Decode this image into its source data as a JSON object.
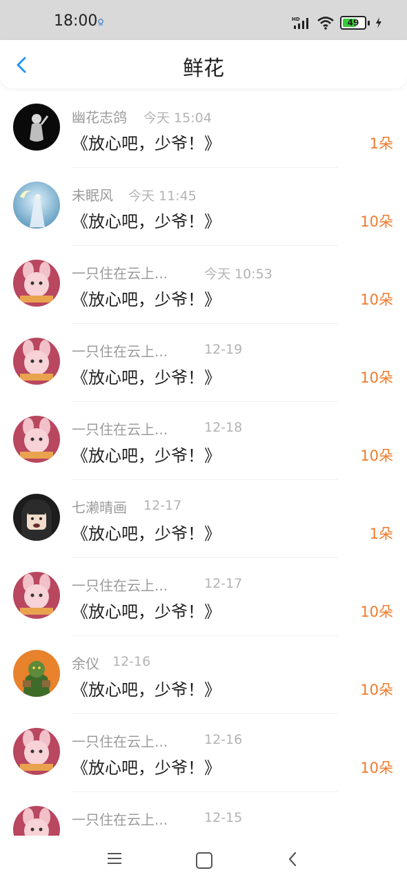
{
  "status_bar": {
    "time": "18:00",
    "battery": "49"
  },
  "header": {
    "title": "鲜花"
  },
  "rows": [
    {
      "name": "幽花志鸽",
      "time": "今天 15:04",
      "title": "《放心吧，少爷！》",
      "count": "1朵",
      "avatar": "avatar-dark-statue"
    },
    {
      "name": "未眠风",
      "time": "今天 11:45",
      "title": "《放心吧，少爷！》",
      "count": "10朵",
      "avatar": "avatar-blue-fantasy"
    },
    {
      "name": "一只住在云上...",
      "time": "今天 10:53",
      "title": "《放心吧，少爷！》",
      "count": "10朵",
      "avatar": "avatar-pink-rabbit"
    },
    {
      "name": "一只住在云上...",
      "time": "12-19",
      "title": "《放心吧，少爷！》",
      "count": "10朵",
      "avatar": "avatar-pink-rabbit"
    },
    {
      "name": "一只住在云上...",
      "time": "12-18",
      "title": "《放心吧，少爷！》",
      "count": "10朵",
      "avatar": "avatar-pink-rabbit"
    },
    {
      "name": "七濑晴画",
      "time": "12-17",
      "title": "《放心吧，少爷！》",
      "count": "1朵",
      "avatar": "avatar-cartoon-girl"
    },
    {
      "name": "一只住在云上...",
      "time": "12-17",
      "title": "《放心吧，少爷！》",
      "count": "10朵",
      "avatar": "avatar-pink-rabbit"
    },
    {
      "name": "余仪",
      "time": "12-16",
      "title": "《放心吧，少爷！》",
      "count": "10朵",
      "avatar": "avatar-green-orc"
    },
    {
      "name": "一只住在云上...",
      "time": "12-16",
      "title": "《放心吧，少爷！》",
      "count": "10朵",
      "avatar": "avatar-pink-rabbit"
    },
    {
      "name": "一只住在云上...",
      "time": "12-15",
      "title": "",
      "count": "",
      "avatar": "avatar-pink-rabbit"
    }
  ],
  "colors": {
    "accent": "#2196f3",
    "count": "#f07a2a",
    "name": "#9a9a9a",
    "time": "#b3b3b3"
  }
}
